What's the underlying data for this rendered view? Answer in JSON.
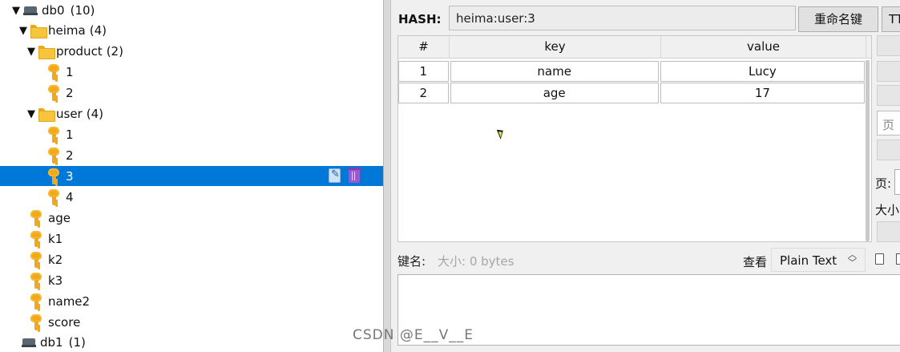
{
  "tree": {
    "db0": {
      "name": "db0",
      "count": "(10)"
    },
    "heima": {
      "name": "heima",
      "count": "(4)"
    },
    "product": {
      "name": "product",
      "count": "(2)"
    },
    "product_keys": [
      "1",
      "2"
    ],
    "user": {
      "name": "user",
      "count": "(4)"
    },
    "user_keys": [
      "1",
      "2",
      "3",
      "4"
    ],
    "selected_key": "3",
    "root_keys": [
      "age",
      "k1",
      "k2",
      "k3",
      "name2",
      "score"
    ],
    "db1": {
      "name": "db1",
      "count": "(1)"
    }
  },
  "detail": {
    "type_label": "HASH:",
    "key_name": "heima:user:3",
    "rename_label": "重命名键",
    "ttl_label": "TTL",
    "table": {
      "headers": [
        "#",
        "key",
        "value"
      ],
      "rows": [
        {
          "index": "1",
          "key": "name",
          "value": "Lucy"
        },
        {
          "index": "2",
          "key": "age",
          "value": "17"
        }
      ]
    },
    "side": {
      "page_input": "页",
      "page_label": "页:",
      "size_label": "大小"
    },
    "bottom": {
      "key_name_label": "键名:",
      "size_text": "大小: 0 bytes",
      "view_label": "查看",
      "format": "Plain Text"
    }
  },
  "watermark": "CSDN @E__V__E",
  "colors": {
    "selection": "#0078d7",
    "key": "#f2a81d",
    "folder": "#f7c53c",
    "trash": "#9b59d0"
  }
}
